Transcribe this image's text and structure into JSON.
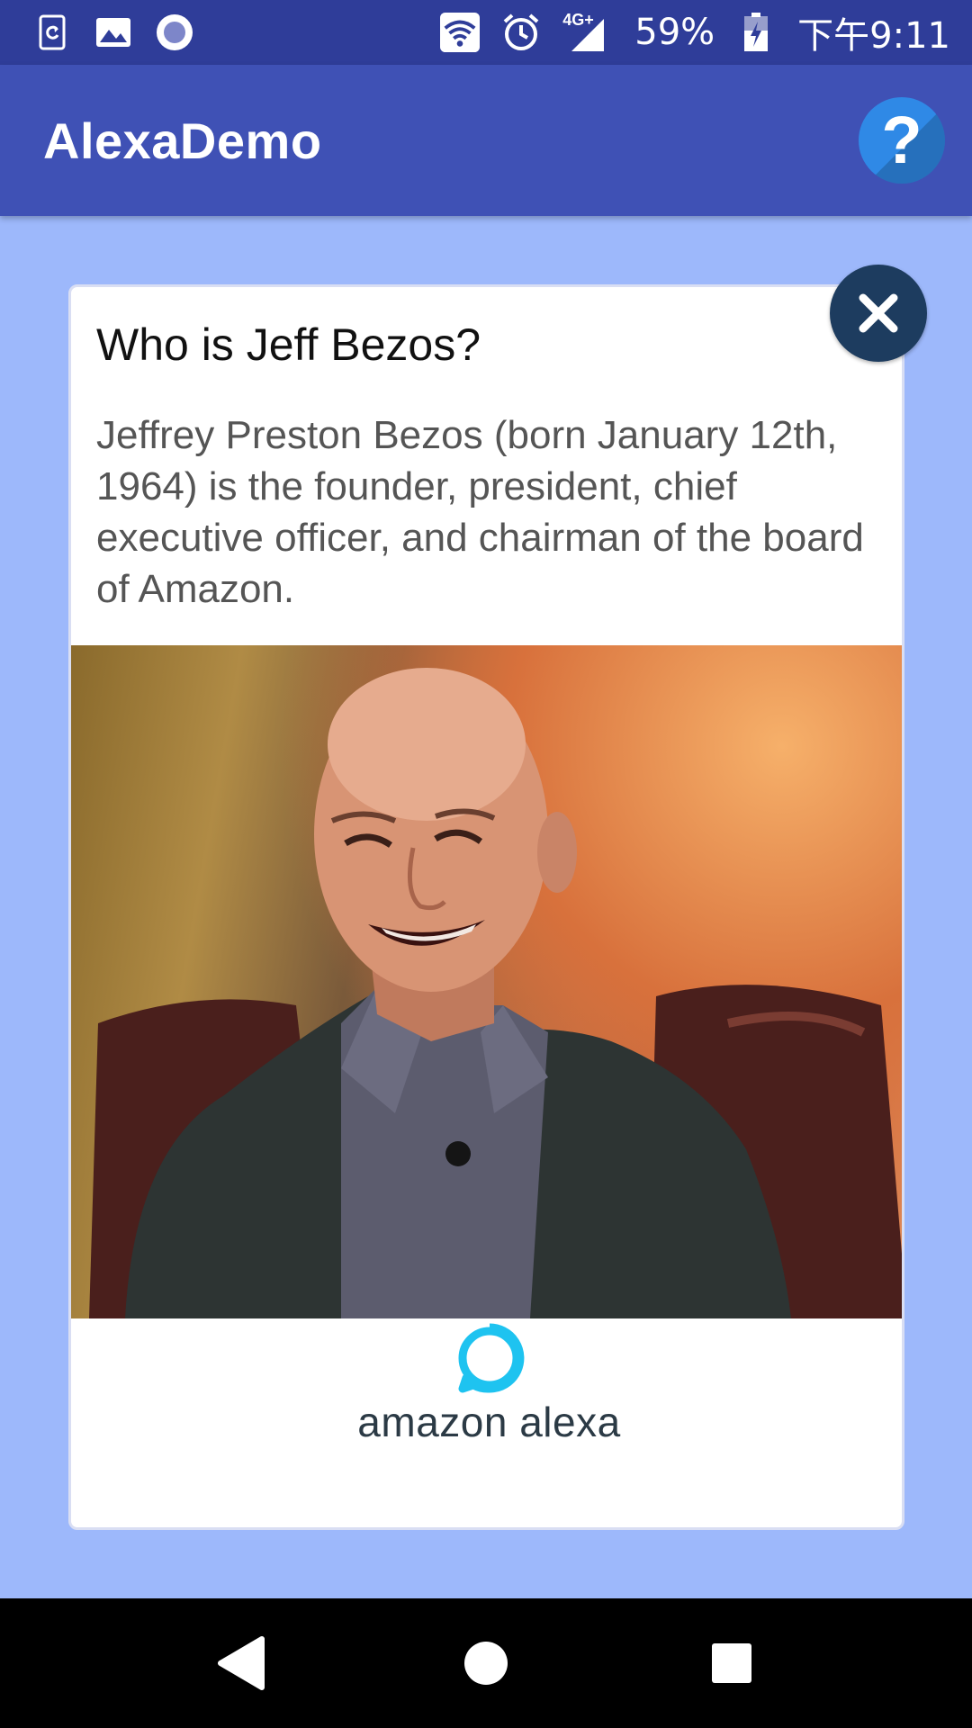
{
  "status_bar": {
    "battery": "59%",
    "time": "下午9:11",
    "network": "4G+",
    "icons": [
      "sync-app-icon",
      "gallery-icon",
      "record-icon",
      "wifi-icon",
      "alarm-icon",
      "signal-icon",
      "battery-icon"
    ]
  },
  "app_bar": {
    "title": "AlexaDemo",
    "help_label": "?"
  },
  "card": {
    "title": "Who is Jeff Bezos?",
    "body": "Jeffrey Preston Bezos (born January 12th, 1964) is the founder, president, chief executive officer, and chairman of the board of Amazon.",
    "logo_text": "amazon alexa"
  },
  "colors": {
    "status_bar": "#2f3d99",
    "app_bar": "#3f51b5",
    "background": "#9db8fb",
    "help_button": "#2f89e6",
    "close_button": "#1d3c5f",
    "alexa_ring": "#1ec3f0"
  }
}
